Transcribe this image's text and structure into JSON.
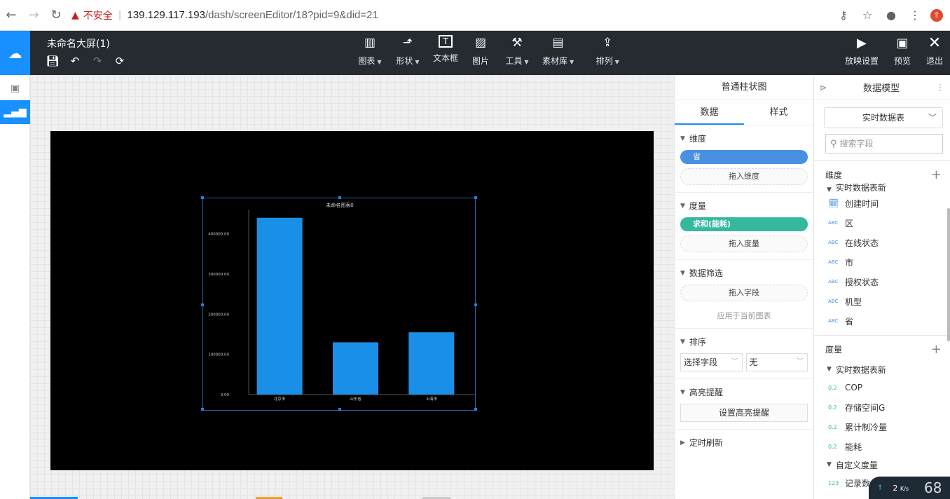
{
  "browser": {
    "insecure_label": "不安全",
    "url_host": "139.129.117.193",
    "url_path": "/dash/screenEditor/18?pid=9&did=21"
  },
  "toolbar": {
    "screen_title": "未命名大屏(1)",
    "center_tools": [
      {
        "label": "图表",
        "icon": "bar-chart-icon",
        "caret": true
      },
      {
        "label": "形状",
        "icon": "shape-icon",
        "caret": true
      },
      {
        "label": "文本框",
        "icon": "textbox-icon",
        "caret": false
      },
      {
        "label": "图片",
        "icon": "image-icon",
        "caret": false
      },
      {
        "label": "工具",
        "icon": "hammer-icon",
        "caret": true
      },
      {
        "label": "素材库",
        "icon": "library-icon",
        "caret": true
      },
      {
        "label": "排列",
        "icon": "arrange-icon",
        "caret": true
      }
    ],
    "right_tools": [
      {
        "label": "放映设置",
        "icon": "play-settings-icon"
      },
      {
        "label": "预览",
        "icon": "preview-icon"
      },
      {
        "label": "退出",
        "icon": "close-icon"
      }
    ]
  },
  "chart_data": {
    "type": "bar",
    "title": "未命名图表0",
    "categories": [
      "北京市",
      "山东省",
      "上海市"
    ],
    "values": [
      440000,
      130000,
      155000
    ],
    "ylim": [
      0,
      450000
    ],
    "yticks": [
      "0.00",
      "100000.00",
      "200000.00",
      "300000.00",
      "400000.00"
    ],
    "ytick_values": [
      0,
      100000,
      200000,
      300000,
      400000
    ],
    "bar_color": "#1a8fe8",
    "xlabel": "",
    "ylabel": "",
    "grid": false
  },
  "props": {
    "title": "普通柱状图",
    "tabs": [
      "数据",
      "样式"
    ],
    "dimension": {
      "head": "维度",
      "pill": "省",
      "drop": "拖入维度"
    },
    "measure": {
      "head": "度量",
      "pill": "求和(能耗)",
      "drop": "拖入度量"
    },
    "filter": {
      "head": "数据筛选",
      "drop": "拖入字段",
      "apply": "应用于当前图表"
    },
    "sort": {
      "head": "排序",
      "field_select": "选择字段",
      "order_select": "无"
    },
    "highlight": {
      "head": "高亮提醒",
      "button": "设置高亮提醒"
    },
    "refresh": {
      "head": "定时刷新"
    }
  },
  "model": {
    "title": "数据模型",
    "source_select": "实时数据表",
    "search_placeholder": "搜索字段",
    "dimension_head": "维度",
    "dimension_group": "实时数据表新",
    "dimension_fields": [
      {
        "type": "cal",
        "name": "创建时间"
      },
      {
        "type": "ABC",
        "name": "区"
      },
      {
        "type": "ABC",
        "name": "在线状态"
      },
      {
        "type": "ABC",
        "name": "市"
      },
      {
        "type": "ABC",
        "name": "授权状态"
      },
      {
        "type": "ABC",
        "name": "机型"
      },
      {
        "type": "ABC",
        "name": "省"
      }
    ],
    "measure_head": "度量",
    "measure_group": "实时数据表新",
    "measure_fields": [
      {
        "type": "0.2",
        "name": "COP"
      },
      {
        "type": "0.2",
        "name": "存储空间G"
      },
      {
        "type": "0.2",
        "name": "累计制冷量"
      },
      {
        "type": "0.2",
        "name": "能耗"
      }
    ],
    "custom_group": "自定义度量",
    "custom_fields": [
      {
        "type": "123",
        "name": "记录数"
      }
    ]
  },
  "netbadge": {
    "speed": "2",
    "unit": "K/s",
    "pct": "68"
  }
}
